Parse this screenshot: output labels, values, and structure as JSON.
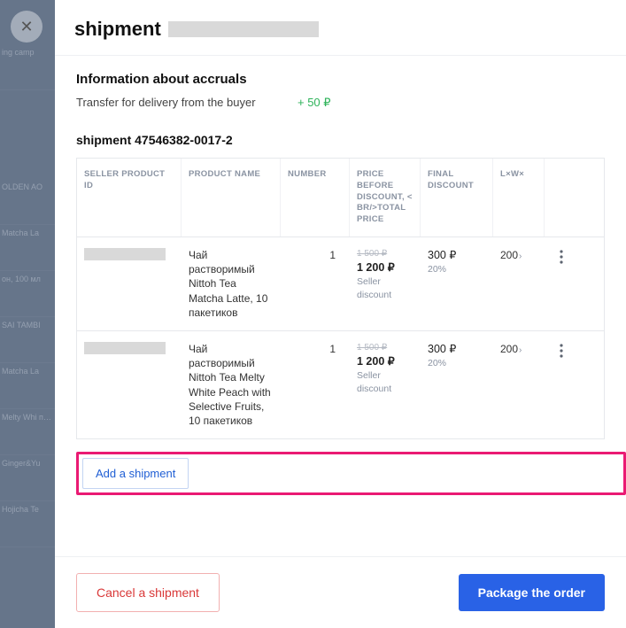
{
  "header": {
    "title_prefix": "shipment"
  },
  "accruals": {
    "section_title": "Information about accruals",
    "transfer_label": "Transfer for delivery from the buyer",
    "transfer_value": "+ 50 ₽"
  },
  "shipment": {
    "label": "shipment 47546382-0017-2"
  },
  "columns": {
    "seller_product_id": "SELLER PRODUCT ID",
    "product_name": "PRODUCT NAME",
    "number": "NUMBER",
    "price": "PRICE BEFORE DISCOUNT, < BR/>TOTAL PRICE",
    "final_discount": "FINAL DISCOUNT",
    "dimensions": "L×W×"
  },
  "rows": [
    {
      "product_name": "Чай растворимый Nittoh Tea Matcha Latte, 10 пакетиков",
      "number": "1",
      "price_before": "1 500 ₽",
      "price_total": "1 200 ₽",
      "price_note": "Seller discount",
      "discount_value": "300 ₽",
      "discount_pct": "20%",
      "dimensions": "200"
    },
    {
      "product_name": "Чай растворимый Nittoh Tea Melty White Peach with Selective Fruits, 10 пакетиков",
      "number": "1",
      "price_before": "1 500 ₽",
      "price_total": "1 200 ₽",
      "price_note": "Seller discount",
      "discount_value": "300 ₽",
      "discount_pct": "20%",
      "dimensions": "200"
    }
  ],
  "buttons": {
    "add_shipment": "Add a shipment",
    "cancel_shipment": "Cancel a shipment",
    "package_order": "Package the order"
  },
  "backdrop_hints": [
    "ing camp",
    "OLDEN AO",
    "Matcha La",
    "он, 100 мл",
    "SAI TAMBI",
    "Matcha La",
    "Melty Whi пакетико",
    "Ginger&Yu",
    "Hojicha Te"
  ]
}
